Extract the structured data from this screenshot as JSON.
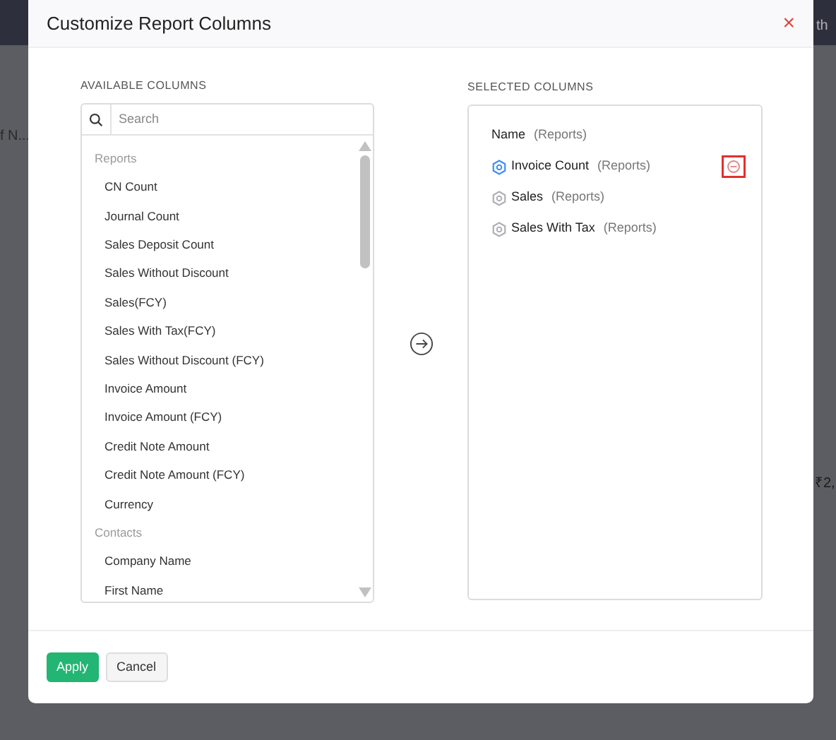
{
  "backdrop": {
    "texts": [
      "f N...",
      "th",
      "₹2,"
    ]
  },
  "dialog": {
    "title": "Customize Report Columns",
    "close": "×"
  },
  "available": {
    "label": "AVAILABLE COLUMNS",
    "search": {
      "placeholder": "Search"
    },
    "groups": [
      {
        "name": "Reports",
        "items": [
          "CN Count",
          "Journal Count",
          "Sales Deposit Count",
          "Sales Without Discount",
          "Sales(FCY)",
          "Sales With Tax(FCY)",
          "Sales Without Discount (FCY)",
          "Invoice Amount",
          "Invoice Amount (FCY)",
          "Credit Note Amount",
          "Credit Note Amount (FCY)",
          "Currency"
        ]
      },
      {
        "name": "Contacts",
        "items": [
          "Company Name",
          "First Name"
        ]
      }
    ]
  },
  "selected": {
    "label": "SELECTED COLUMNS",
    "items": [
      {
        "kind": "fixed",
        "name": "Name",
        "source": "(Reports)",
        "highlighted": false
      },
      {
        "kind": "movable",
        "name": "Invoice Count",
        "source": "(Reports)",
        "highlighted": true
      },
      {
        "kind": "movable",
        "name": "Sales",
        "source": "(Reports)",
        "highlighted": false
      },
      {
        "kind": "movable",
        "name": "Sales With Tax",
        "source": "(Reports)",
        "highlighted": false
      }
    ]
  },
  "buttons": [
    {
      "kind": "primary",
      "label": "Apply"
    },
    {
      "kind": "secondary",
      "label": "Cancel"
    }
  ]
}
